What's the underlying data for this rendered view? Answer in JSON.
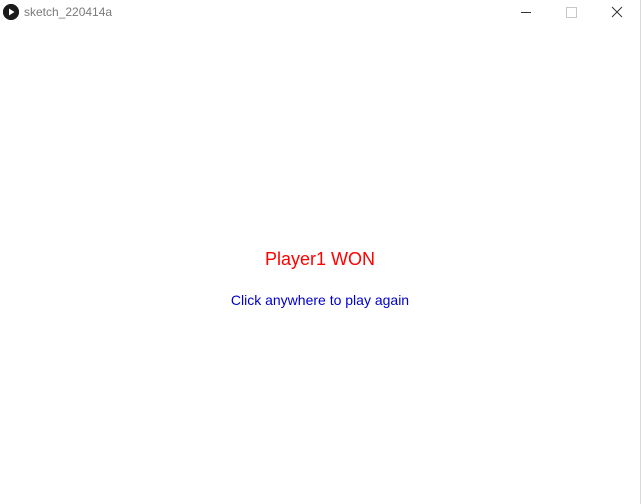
{
  "window": {
    "title": "sketch_220414a",
    "app_icon": "processing-play-icon",
    "controls": {
      "minimize_icon": "minimize-icon",
      "maximize_icon": "maximize-icon",
      "close_icon": "close-icon"
    }
  },
  "canvas": {
    "background": "#ffffff",
    "win_message": "Player1 WON",
    "win_message_color": "#ff0000",
    "restart_prompt": "Click anywhere to play again",
    "restart_prompt_color": "#0000cc"
  }
}
